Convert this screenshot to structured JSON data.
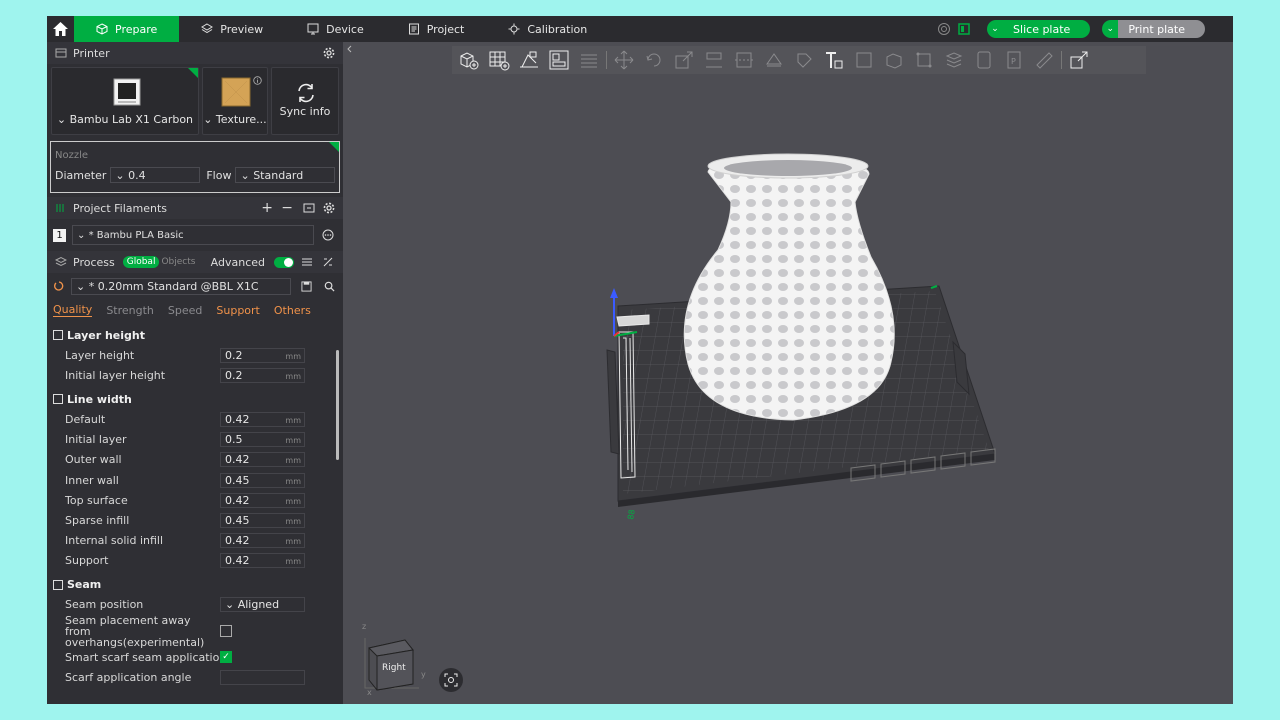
{
  "topbar": {
    "tabs": [
      {
        "label": "Prepare",
        "icon": "cube-icon"
      },
      {
        "label": "Preview",
        "icon": "layers-icon"
      },
      {
        "label": "Device",
        "icon": "device-icon"
      },
      {
        "label": "Project",
        "icon": "project-icon"
      },
      {
        "label": "Calibration",
        "icon": "calibration-icon"
      }
    ],
    "slice_label": "Slice plate",
    "print_label": "Print plate"
  },
  "printer": {
    "header": "Printer",
    "name": "Bambu Lab X1 Carbon",
    "plate": "Texture...",
    "sync": "Sync info",
    "nozzle_title": "Nozzle",
    "diameter_label": "Diameter",
    "diameter_value": "0.4",
    "flow_label": "Flow",
    "flow_value": "Standard"
  },
  "filaments": {
    "header": "Project Filaments",
    "items": [
      {
        "num": "1",
        "name": "* Bambu PLA Basic",
        "color": "#f2f2f2"
      }
    ]
  },
  "process": {
    "header": "Process",
    "global": "Global",
    "objects": "Objects",
    "advanced": "Advanced",
    "preset": "* 0.20mm Standard @BBL X1C",
    "tabs": [
      "Quality",
      "Strength",
      "Speed",
      "Support",
      "Others"
    ],
    "groups": {
      "layer_height": {
        "title": "Layer height",
        "rows": [
          {
            "label": "Layer height",
            "value": "0.2",
            "unit": "mm"
          },
          {
            "label": "Initial layer height",
            "value": "0.2",
            "unit": "mm"
          }
        ]
      },
      "line_width": {
        "title": "Line width",
        "rows": [
          {
            "label": "Default",
            "value": "0.42",
            "unit": "mm"
          },
          {
            "label": "Initial layer",
            "value": "0.5",
            "unit": "mm"
          },
          {
            "label": "Outer wall",
            "value": "0.42",
            "unit": "mm"
          },
          {
            "label": "Inner wall",
            "value": "0.45",
            "unit": "mm"
          },
          {
            "label": "Top surface",
            "value": "0.42",
            "unit": "mm"
          },
          {
            "label": "Sparse infill",
            "value": "0.45",
            "unit": "mm"
          },
          {
            "label": "Internal solid infill",
            "value": "0.42",
            "unit": "mm"
          },
          {
            "label": "Support",
            "value": "0.42",
            "unit": "mm"
          }
        ]
      },
      "seam": {
        "title": "Seam",
        "position_label": "Seam position",
        "position_value": "Aligned",
        "placement_label": "Seam placement away from overhangs(experimental)",
        "scarf_label": "Smart scarf seam application",
        "scarf_angle_label": "Scarf application angle"
      }
    }
  },
  "viewport": {
    "cube_label": "Right",
    "axis_z": "z",
    "axis_y": "y",
    "axis_x": "x",
    "accent": "#00ae42"
  }
}
